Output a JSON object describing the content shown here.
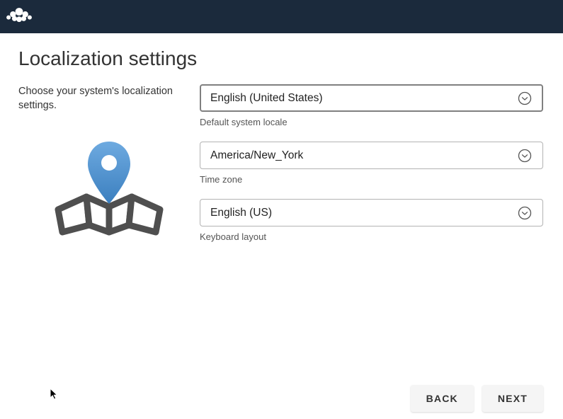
{
  "page": {
    "title": "Localization settings",
    "subtitle": "Choose your system's localization settings."
  },
  "fields": {
    "locale": {
      "value": "English (United States)",
      "label": "Default system locale"
    },
    "timezone": {
      "value": "America/New_York",
      "label": "Time zone"
    },
    "keyboard": {
      "value": "English (US)",
      "label": "Keyboard layout"
    }
  },
  "footer": {
    "back": "BACK",
    "next": "NEXT"
  }
}
